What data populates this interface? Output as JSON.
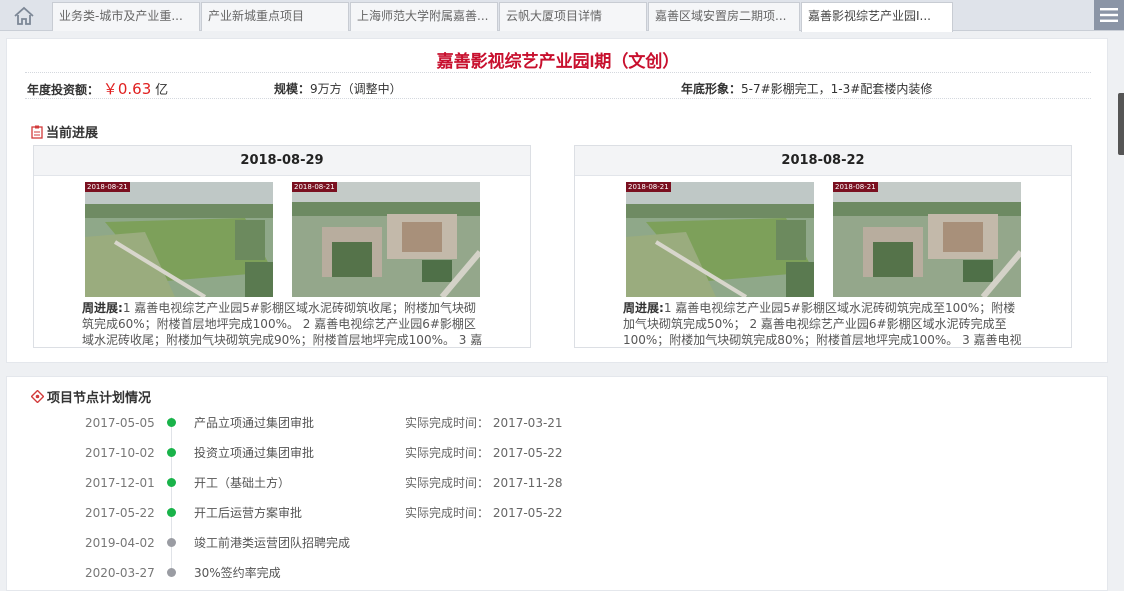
{
  "tabs": [
    {
      "label": "业务类-城市及产业重..."
    },
    {
      "label": "产业新城重点项目"
    },
    {
      "label": "上海师范大学附属嘉善..."
    },
    {
      "label": "云帆大厦项目详情"
    },
    {
      "label": "嘉善区域安置房二期项..."
    },
    {
      "label": "嘉善影视综艺产业园I..."
    }
  ],
  "header": {
    "title": "嘉善影视综艺产业园I期（文创）"
  },
  "info": {
    "investment_label": "年度投资额：",
    "investment_value": "￥0.63",
    "investment_unit": "亿",
    "scale_label": "规模：",
    "scale_value": "9万方（调整中）",
    "year_end_label": "年底形象：",
    "year_end_value": "5-7#影棚完工，1-3#配套楼内装修"
  },
  "progress": {
    "section_title": "当前进展",
    "cards": [
      {
        "date": "2018-08-29",
        "stamps": [
          "2018-08-21",
          "2018-08-21"
        ],
        "text_label": "周进展:",
        "text": "1 嘉善电视综艺产业园5#影棚区域水泥砖砌筑收尾；附楼加气块砌筑完成60%；附楼首层地坪完成100%。 2 嘉善电视综艺产业园6#影棚区域水泥砖收尾；附楼加气块砌筑完成90%；附楼首层地坪完成100%。 3 嘉善"
      },
      {
        "date": "2018-08-22",
        "stamps": [
          "2018-08-21",
          "2018-08-21"
        ],
        "text_label": "周进展:",
        "text": "1 嘉善电视综艺产业园5#影棚区域水泥砖砌筑完成至100%；附楼加气块砌筑完成50%； 2 嘉善电视综艺产业园6#影棚区域水泥砖完成至100%；附楼加气块砌筑完成80%；附楼首层地坪完成100%。 3 嘉善电视"
      }
    ]
  },
  "plan": {
    "section_title": "项目节点计划情况",
    "actual_prefix": "实际完成时间：",
    "nodes": [
      {
        "date": "2017-05-05",
        "label": "产品立项通过集团审批",
        "actual": "实际完成时间： 2017-03-21",
        "status": "done"
      },
      {
        "date": "2017-10-02",
        "label": "投资立项通过集团审批",
        "actual": "实际完成时间： 2017-05-22",
        "status": "done"
      },
      {
        "date": "2017-12-01",
        "label": "开工（基础土方）",
        "actual": "实际完成时间： 2017-11-28",
        "status": "done"
      },
      {
        "date": "2017-05-22",
        "label": "开工后运营方案审批",
        "actual": "实际完成时间： 2017-05-22",
        "status": "done"
      },
      {
        "date": "2019-04-02",
        "label": "竣工前港类运营团队招聘完成",
        "actual": "",
        "status": "pending"
      },
      {
        "date": "2020-03-27",
        "label": "30%签约率完成",
        "actual": "",
        "status": "pending"
      }
    ]
  },
  "colors": {
    "title_red": "#c8102e",
    "done_green": "#19b34a",
    "pending_gray": "#9a9ca3"
  },
  "icons": {
    "home": "home-icon",
    "menu": "hamburger-menu-icon",
    "progress": "clipboard-icon",
    "plan": "node-plan-icon"
  }
}
